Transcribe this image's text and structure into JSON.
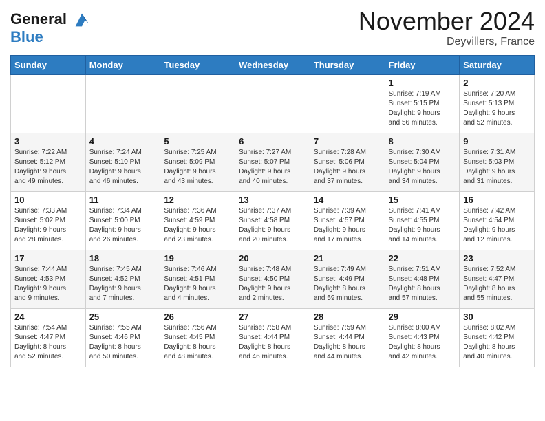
{
  "header": {
    "logo_line1": "General",
    "logo_line2": "Blue",
    "month": "November 2024",
    "location": "Deyvillers, France"
  },
  "weekdays": [
    "Sunday",
    "Monday",
    "Tuesday",
    "Wednesday",
    "Thursday",
    "Friday",
    "Saturday"
  ],
  "weeks": [
    [
      {
        "day": "",
        "info": ""
      },
      {
        "day": "",
        "info": ""
      },
      {
        "day": "",
        "info": ""
      },
      {
        "day": "",
        "info": ""
      },
      {
        "day": "",
        "info": ""
      },
      {
        "day": "1",
        "info": "Sunrise: 7:19 AM\nSunset: 5:15 PM\nDaylight: 9 hours\nand 56 minutes."
      },
      {
        "day": "2",
        "info": "Sunrise: 7:20 AM\nSunset: 5:13 PM\nDaylight: 9 hours\nand 52 minutes."
      }
    ],
    [
      {
        "day": "3",
        "info": "Sunrise: 7:22 AM\nSunset: 5:12 PM\nDaylight: 9 hours\nand 49 minutes."
      },
      {
        "day": "4",
        "info": "Sunrise: 7:24 AM\nSunset: 5:10 PM\nDaylight: 9 hours\nand 46 minutes."
      },
      {
        "day": "5",
        "info": "Sunrise: 7:25 AM\nSunset: 5:09 PM\nDaylight: 9 hours\nand 43 minutes."
      },
      {
        "day": "6",
        "info": "Sunrise: 7:27 AM\nSunset: 5:07 PM\nDaylight: 9 hours\nand 40 minutes."
      },
      {
        "day": "7",
        "info": "Sunrise: 7:28 AM\nSunset: 5:06 PM\nDaylight: 9 hours\nand 37 minutes."
      },
      {
        "day": "8",
        "info": "Sunrise: 7:30 AM\nSunset: 5:04 PM\nDaylight: 9 hours\nand 34 minutes."
      },
      {
        "day": "9",
        "info": "Sunrise: 7:31 AM\nSunset: 5:03 PM\nDaylight: 9 hours\nand 31 minutes."
      }
    ],
    [
      {
        "day": "10",
        "info": "Sunrise: 7:33 AM\nSunset: 5:02 PM\nDaylight: 9 hours\nand 28 minutes."
      },
      {
        "day": "11",
        "info": "Sunrise: 7:34 AM\nSunset: 5:00 PM\nDaylight: 9 hours\nand 26 minutes."
      },
      {
        "day": "12",
        "info": "Sunrise: 7:36 AM\nSunset: 4:59 PM\nDaylight: 9 hours\nand 23 minutes."
      },
      {
        "day": "13",
        "info": "Sunrise: 7:37 AM\nSunset: 4:58 PM\nDaylight: 9 hours\nand 20 minutes."
      },
      {
        "day": "14",
        "info": "Sunrise: 7:39 AM\nSunset: 4:57 PM\nDaylight: 9 hours\nand 17 minutes."
      },
      {
        "day": "15",
        "info": "Sunrise: 7:41 AM\nSunset: 4:55 PM\nDaylight: 9 hours\nand 14 minutes."
      },
      {
        "day": "16",
        "info": "Sunrise: 7:42 AM\nSunset: 4:54 PM\nDaylight: 9 hours\nand 12 minutes."
      }
    ],
    [
      {
        "day": "17",
        "info": "Sunrise: 7:44 AM\nSunset: 4:53 PM\nDaylight: 9 hours\nand 9 minutes."
      },
      {
        "day": "18",
        "info": "Sunrise: 7:45 AM\nSunset: 4:52 PM\nDaylight: 9 hours\nand 7 minutes."
      },
      {
        "day": "19",
        "info": "Sunrise: 7:46 AM\nSunset: 4:51 PM\nDaylight: 9 hours\nand 4 minutes."
      },
      {
        "day": "20",
        "info": "Sunrise: 7:48 AM\nSunset: 4:50 PM\nDaylight: 9 hours\nand 2 minutes."
      },
      {
        "day": "21",
        "info": "Sunrise: 7:49 AM\nSunset: 4:49 PM\nDaylight: 8 hours\nand 59 minutes."
      },
      {
        "day": "22",
        "info": "Sunrise: 7:51 AM\nSunset: 4:48 PM\nDaylight: 8 hours\nand 57 minutes."
      },
      {
        "day": "23",
        "info": "Sunrise: 7:52 AM\nSunset: 4:47 PM\nDaylight: 8 hours\nand 55 minutes."
      }
    ],
    [
      {
        "day": "24",
        "info": "Sunrise: 7:54 AM\nSunset: 4:47 PM\nDaylight: 8 hours\nand 52 minutes."
      },
      {
        "day": "25",
        "info": "Sunrise: 7:55 AM\nSunset: 4:46 PM\nDaylight: 8 hours\nand 50 minutes."
      },
      {
        "day": "26",
        "info": "Sunrise: 7:56 AM\nSunset: 4:45 PM\nDaylight: 8 hours\nand 48 minutes."
      },
      {
        "day": "27",
        "info": "Sunrise: 7:58 AM\nSunset: 4:44 PM\nDaylight: 8 hours\nand 46 minutes."
      },
      {
        "day": "28",
        "info": "Sunrise: 7:59 AM\nSunset: 4:44 PM\nDaylight: 8 hours\nand 44 minutes."
      },
      {
        "day": "29",
        "info": "Sunrise: 8:00 AM\nSunset: 4:43 PM\nDaylight: 8 hours\nand 42 minutes."
      },
      {
        "day": "30",
        "info": "Sunrise: 8:02 AM\nSunset: 4:42 PM\nDaylight: 8 hours\nand 40 minutes."
      }
    ]
  ]
}
